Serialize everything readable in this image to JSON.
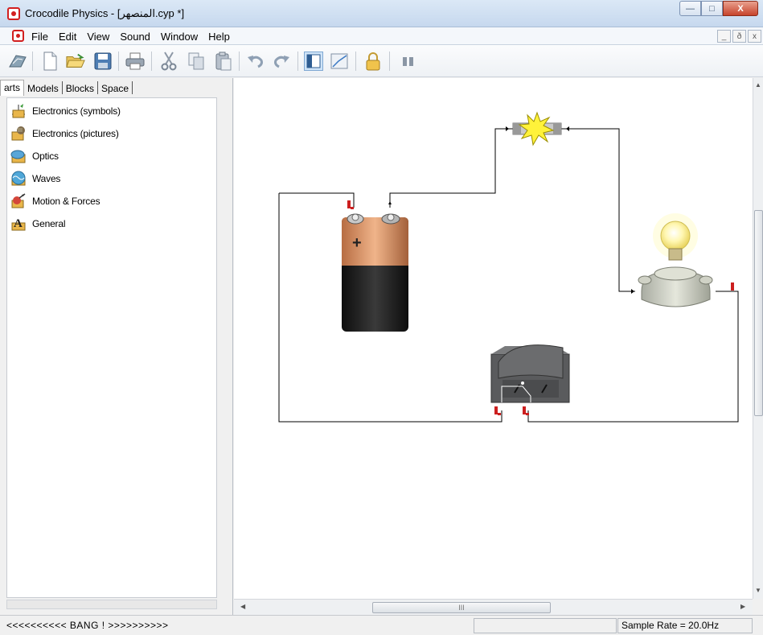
{
  "window": {
    "title": "Crocodile Physics - [المنصهر.cyp *]"
  },
  "window_controls": {
    "minimize": "—",
    "maximize": "□",
    "close": "X"
  },
  "menu": {
    "items": [
      "File",
      "Edit",
      "View",
      "Sound",
      "Window",
      "Help"
    ],
    "mdi_controls": [
      "_",
      "ð",
      "x"
    ]
  },
  "toolbar": {
    "buttons": [
      "parts-bin",
      "new",
      "open",
      "save",
      "print",
      "cut",
      "copy",
      "paste",
      "undo",
      "redo",
      "parts-panel",
      "graph",
      "lock",
      "pause"
    ]
  },
  "left_panel": {
    "tabs": [
      "arts",
      "Models",
      "Blocks",
      "Space"
    ],
    "active_tab": "arts",
    "tree": [
      {
        "label": "Electronics (symbols)",
        "icon": "resistor-symbol-icon"
      },
      {
        "label": "Electronics (pictures)",
        "icon": "electronics-picture-icon"
      },
      {
        "label": "Optics",
        "icon": "optics-icon"
      },
      {
        "label": "Waves",
        "icon": "waves-icon"
      },
      {
        "label": "Motion & Forces",
        "icon": "motion-forces-icon"
      },
      {
        "label": "General",
        "icon": "general-icon"
      }
    ]
  },
  "canvas": {
    "components": [
      "battery",
      "fuse",
      "lamp",
      "switch"
    ],
    "battery_polarity_label": "+"
  },
  "scrollbars": {
    "h_thumb_grip": "III"
  },
  "statusbar": {
    "message": "<<<<<<<<<<  BANG !  >>>>>>>>>>",
    "sample_rate": "Sample Rate =  20.0Hz"
  }
}
